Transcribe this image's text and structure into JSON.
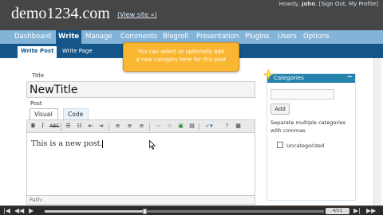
{
  "header": {
    "site_title": "demo1234.com",
    "view_site": "(View site »)",
    "howdy_prefix": "Howdy,",
    "user": "john",
    "sign_out": "Sign Out",
    "my_profile": "My Profile"
  },
  "menu": {
    "items": [
      "Dashboard",
      "Write",
      "Manage",
      "Comments",
      "Blogroll",
      "Presentation",
      "Plugins",
      "Users",
      "Options"
    ],
    "active": "Write"
  },
  "submenu": {
    "items": [
      "Write Post",
      "Write Page"
    ],
    "active": "Write Post"
  },
  "tooltip": {
    "line1": "You can select or optionally add",
    "line2": "a new category here for this post"
  },
  "editor": {
    "title_label": "Title",
    "title_value": "NewTitle",
    "post_label": "Post",
    "tab_visual": "Visual",
    "tab_code": "Code",
    "active_tab": "Visual",
    "content": "This is a new post.",
    "path_label": "Path:",
    "toolbar_icons": [
      "bold-icon",
      "italic-icon",
      "strikethrough-icon",
      "bullet-list-icon",
      "numbered-list-icon",
      "outdent-icon",
      "indent-icon",
      "align-left-icon",
      "align-center-icon",
      "align-right-icon",
      "link-icon",
      "unlink-icon",
      "image-icon",
      "more-icon",
      "spellcheck-icon",
      "help-icon",
      "fullscreen-icon"
    ]
  },
  "categories": {
    "header": "Categories",
    "add_button": "Add",
    "help_line1": "Separate multiple categories",
    "help_line2": "with commas.",
    "items": [
      {
        "label": "Uncategorized",
        "checked": false
      }
    ]
  },
  "player": {
    "progress": 0.36,
    "counter": "4/11"
  },
  "colors": {
    "header_bg": "#464646",
    "menu_bg": "#83b4d8",
    "active_bg": "#14568a",
    "tooltip_bg": "#f9b631",
    "category_header_bg": "#2683ae"
  }
}
